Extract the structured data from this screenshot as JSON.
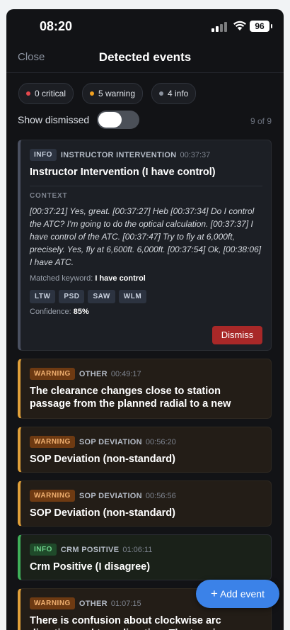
{
  "status": {
    "time": "08:20",
    "battery": "96"
  },
  "header": {
    "close_label": "Close",
    "title": "Detected events"
  },
  "filters": [
    {
      "label": "0 critical",
      "dot_color": "#e5484d"
    },
    {
      "label": "5 warning",
      "dot_color": "#f0a020"
    },
    {
      "label": "4 info",
      "dot_color": "#8b929e"
    }
  ],
  "show_dismissed": {
    "label": "Show dismissed",
    "count": "9 of 9"
  },
  "events": [
    {
      "badge": "INFO",
      "category": "INSTRUCTOR INTERVENTION",
      "time": "00:37:37",
      "title": "Instructor Intervention (I have control)",
      "context_label": "CONTEXT",
      "context": "[00:37:21] Yes, great. [00:37:27] Heb [00:37:34] Do I control the ATC? I'm going to do the optical calculation. [00:37:37] I have control of the ATC. [00:37:47] Try to fly at 6,000ft, precisely. Yes, fly at 6,600ft. 6,000ft. [00:37:54] Ok, [00:38:06] I have ATC.",
      "matched_label": "Matched keyword:",
      "matched_value": "I have control",
      "tags": [
        "LTW",
        "PSD",
        "SAW",
        "WLM"
      ],
      "confidence_label": "Confidence:",
      "confidence_value": "85%",
      "dismiss_label": "Dismiss"
    },
    {
      "badge": "WARNING",
      "category": "OTHER",
      "time": "00:49:17",
      "title": "The clearance changes close to station passage from the planned radial to a new"
    },
    {
      "badge": "WARNING",
      "category": "SOP DEVIATION",
      "time": "00:56:20",
      "title": "SOP Deviation (non-standard)"
    },
    {
      "badge": "WARNING",
      "category": "SOP DEVIATION",
      "time": "00:56:56",
      "title": "SOP Deviation (non-standard)"
    },
    {
      "badge": "INFO",
      "category": "CRM POSITIVE",
      "time": "01:06:11",
      "title": "Crm Positive (I disagree)"
    },
    {
      "badge": "WARNING",
      "category": "OTHER",
      "time": "01:07:15",
      "title": "There is confusion about clockwise arc direction and turn direction. The turn is"
    }
  ],
  "fab": {
    "plus": "+",
    "label": "Add event"
  }
}
